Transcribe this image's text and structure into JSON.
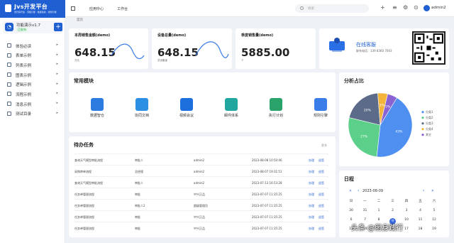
{
  "brand": {
    "title": "Jvs开发平台",
    "subtitle": "低代码开发 · 流程引擎 · 数据建模 · 规则引擎"
  },
  "app": {
    "name": "功能演示v1.7",
    "tag": "已发布",
    "icon_char": "◔",
    "plus": "+"
  },
  "nav": [
    "体验必读",
    "表单示例",
    "列表示例",
    "图表示例",
    "逻辑示例",
    "流程示例",
    "消息示例",
    "测试目录"
  ],
  "topbar": {
    "tabs": [
      "应用中心",
      "工作台"
    ],
    "search_placeholder": "搜索",
    "user": "admin2",
    "icons": [
      "+",
      "≡",
      "⚙",
      "⊙"
    ]
  },
  "crumb": "首页",
  "kpis": [
    {
      "title": "本周销售金额(demo)",
      "value": "648.15",
      "unit": "万元"
    },
    {
      "title": "设备总量(demo)",
      "value": "648.15",
      "unit": "总设备量"
    },
    {
      "title": "季度销售量(demo)",
      "value": "5885.00",
      "unit": "个"
    }
  ],
  "service": {
    "title": "在线客服",
    "phone": "联系电话：139 8360 7003"
  },
  "modules": {
    "title": "常用模块",
    "items": [
      {
        "label": "数据智仓",
        "color": "#2b7be0"
      },
      {
        "label": "协同文档",
        "color": "#2b8fe3"
      },
      {
        "label": "视频会议",
        "color": "#1c6fdc"
      },
      {
        "label": "邮件体系",
        "color": "#21a7a0"
      },
      {
        "label": "执行计划",
        "color": "#2aa36b"
      },
      {
        "label": "规则引擎",
        "color": "#3a7ce8"
      }
    ]
  },
  "todo": {
    "title": "待办任务",
    "more": "更多",
    "actions": [
      "办理",
      "退签"
    ],
    "rows": [
      {
        "name": "查询天气模型审批流程",
        "node": "审批人",
        "user": "admin2",
        "time": "2023-08-08 10:50:46"
      },
      {
        "name": "采购审单流程",
        "node": "总经理",
        "user": "admin2",
        "time": "2023-08-07 19:31:51"
      },
      {
        "name": "查询天气模型审批流程",
        "node": "审批人",
        "user": "admin2",
        "time": "2023-07-13 16:53:28"
      },
      {
        "name": "任务单管理流程",
        "node": "审批",
        "user": "中兴正品",
        "time": "2023-07-07 11:35:25"
      },
      {
        "name": "任务单管理流程",
        "node": "审批人2",
        "user": "超级管理员",
        "time": "2023-07-07 11:35:25"
      },
      {
        "name": "任务单管理流程",
        "node": "审批",
        "user": "中兴正品",
        "time": "2023-07-07 11:35:25"
      },
      {
        "name": "任务单管理流程",
        "node": "审批",
        "user": "中兴正品",
        "time": "2023-07-07 11:35:25"
      }
    ]
  },
  "analysis": {
    "title": "分析占比"
  },
  "chart_data": {
    "type": "pie",
    "title": "分析占比",
    "series": [
      {
        "values": [
          43,
          27,
          20,
          5,
          5
        ]
      }
    ],
    "categories": [
      "分类1",
      "分类2",
      "分类3",
      "分类4",
      "其它"
    ],
    "data_labels": [
      "43%",
      "27%",
      "20%",
      "5%",
      "5%"
    ],
    "colors": [
      "#4f8ff0",
      "#5cd08b",
      "#5b6b88",
      "#f4b43a",
      "#8a63d2"
    ],
    "legend_position": "right"
  },
  "calendar": {
    "title": "日程",
    "month": "2023-08-09",
    "prev": [
      "«",
      "‹"
    ],
    "next": [
      "›",
      "»"
    ],
    "weekdays": [
      "日",
      "一",
      "二",
      "三",
      "四",
      "五",
      "六"
    ],
    "weeks": [
      [
        "30",
        "31",
        "1",
        "2",
        "3",
        "4",
        "5"
      ],
      [
        "6",
        "7",
        "8",
        "9",
        "10",
        "11",
        "12"
      ],
      [
        "13",
        "14",
        "15",
        "16",
        "17",
        "18",
        "19"
      ]
    ],
    "current": "9"
  },
  "watermark": "头条 @躬身践行"
}
